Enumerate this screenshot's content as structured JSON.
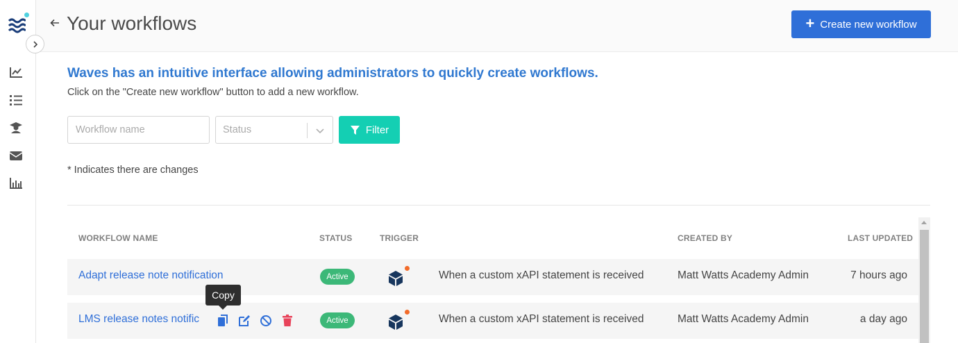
{
  "header": {
    "title": "Your workflows",
    "create_button": "Create new workflow"
  },
  "intro": {
    "title": "Waves has an intuitive interface allowing administrators to quickly create workflows.",
    "subtitle": "Click on the \"Create new workflow\" button to add a new workflow."
  },
  "filters": {
    "name_placeholder": "Workflow name",
    "status_placeholder": "Status",
    "filter_button": "Filter"
  },
  "changes_note": "* Indicates there are changes",
  "table": {
    "columns": {
      "name": "WORKFLOW NAME",
      "status": "STATUS",
      "trigger": "TRIGGER",
      "created_by": "CREATED BY",
      "last_updated": "LAST UPDATED"
    },
    "rows": [
      {
        "name": "Adapt release note notification",
        "status": "Active",
        "trigger": "When a custom xAPI statement is received",
        "created_by": "Matt Watts Academy Admin",
        "last_updated": "7 hours ago"
      },
      {
        "name": "LMS release notes notific",
        "status": "Active",
        "trigger": "When a custom xAPI statement is received",
        "created_by": "Matt Watts Academy Admin",
        "last_updated": "a day ago"
      }
    ]
  },
  "tooltip": "Copy",
  "colors": {
    "primary": "#2f6fd8",
    "filter": "#14cfb3",
    "active_badge": "#3cb878",
    "delete": "#e8435a",
    "trigger_icon": "#17365d",
    "trigger_dot": "#f26b2a"
  },
  "icons": {
    "logo": "waves-logo",
    "nav": [
      "trend-chart-icon",
      "list-icon",
      "graduate-icon",
      "mail-icon",
      "bar-chart-icon"
    ],
    "row_actions": [
      "copy-icon",
      "edit-icon",
      "disable-icon",
      "delete-icon"
    ]
  }
}
